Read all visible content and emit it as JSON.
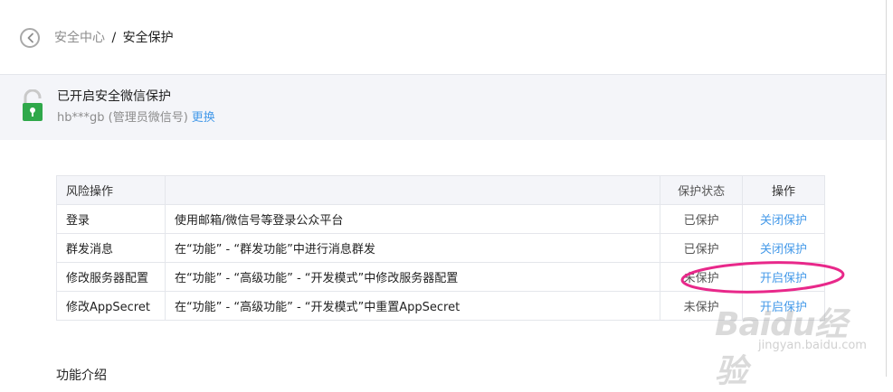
{
  "breadcrumb": {
    "parent": "安全中心",
    "separator": "/",
    "current": "安全保护"
  },
  "status": {
    "title": "已开启安全微信保护",
    "account": "hb***gb (管理员微信号)",
    "change_link": "更换"
  },
  "table": {
    "headers": [
      "风险操作",
      "",
      "保护状态",
      "操作"
    ],
    "rows": [
      {
        "operation": "登录",
        "description": "使用邮箱/微信号等登录公众平台",
        "state": "已保护",
        "action": "关闭保护"
      },
      {
        "operation": "群发消息",
        "description": "在“功能” - “群发功能”中进行消息群发",
        "state": "已保护",
        "action": "关闭保护"
      },
      {
        "operation": "修改服务器配置",
        "description": "在“功能” - “高级功能” - “开发模式”中修改服务器配置",
        "state": "未保护",
        "action": "开启保护"
      },
      {
        "operation": "修改AppSecret",
        "description": "在“功能” - “高级功能” - “开发模式”中重置AppSecret",
        "state": "未保护",
        "action": "开启保护"
      }
    ]
  },
  "next_section": {
    "heading": "功能介绍"
  },
  "watermark": {
    "logo": "Baidu经验",
    "url": "jingyan.baidu.com"
  },
  "colors": {
    "link": "#459ae9",
    "lock_green": "#2fa84a",
    "panel_bg": "#f4f5f9",
    "annotation": "#e8288a"
  },
  "icons": {
    "back": "chevron-left-circle-icon",
    "lock": "unlocked-padlock-icon"
  }
}
